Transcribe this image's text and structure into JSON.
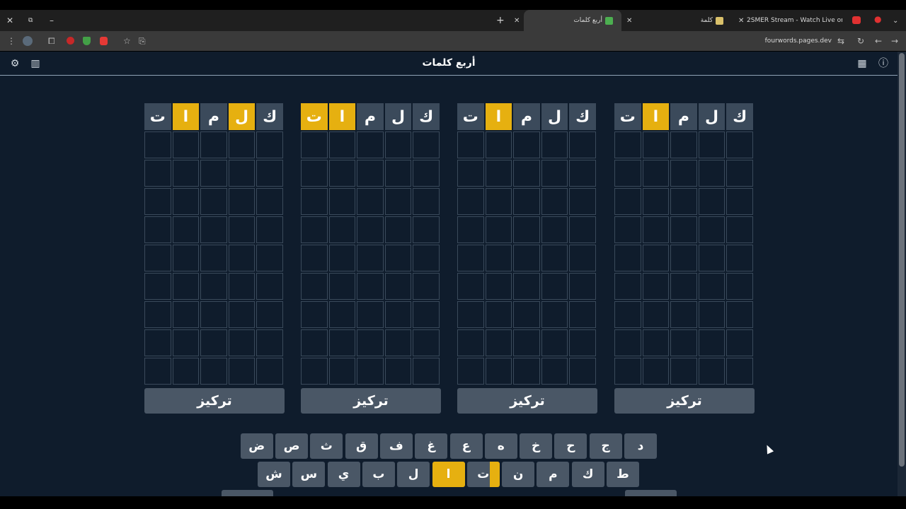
{
  "browser": {
    "tabs": [
      {
        "title": "أربع كلمات",
        "favicon_color": "#4caf50"
      },
      {
        "title": "كلمة",
        "favicon_color": "#d9c06a"
      },
      {
        "title": "2SMER Stream - Watch Live on",
        "favicon_color": "#53fc18"
      }
    ],
    "url": "fourwords.pages.dev",
    "new_tab": "+",
    "close_glyph": "✕"
  },
  "app": {
    "title": "أربع كلمات",
    "focus_label": "تركيز",
    "boards": [
      {
        "letters": [
          "ت",
          "ا",
          "م",
          "ل",
          "ك"
        ],
        "states": [
          "gray",
          "yellow",
          "gray",
          "yellow",
          "gray"
        ]
      },
      {
        "letters": [
          "ت",
          "ا",
          "م",
          "ل",
          "ك"
        ],
        "states": [
          "yellow",
          "yellow",
          "gray",
          "gray",
          "gray"
        ]
      },
      {
        "letters": [
          "ت",
          "ا",
          "م",
          "ل",
          "ك"
        ],
        "states": [
          "gray",
          "yellow",
          "gray",
          "gray",
          "gray"
        ]
      },
      {
        "letters": [
          "ت",
          "ا",
          "م",
          "ل",
          "ك"
        ],
        "states": [
          "gray",
          "yellow",
          "gray",
          "gray",
          "gray"
        ]
      }
    ],
    "keyboard": {
      "row1": [
        "د",
        "ج",
        "ح",
        "خ",
        "ه",
        "ع",
        "غ",
        "ف",
        "ق",
        "ث",
        "ص",
        "ض"
      ],
      "row2": [
        "ط",
        "ك",
        "م",
        "ن",
        "ت",
        "ا",
        "ل",
        "ب",
        "ي",
        "س",
        "ش"
      ],
      "row2_states": [
        "gray",
        "gray",
        "gray",
        "gray",
        "split",
        "yellow",
        "gray",
        "gray",
        "gray",
        "gray",
        "gray"
      ]
    }
  },
  "colors": {
    "background": "#0f1c2c",
    "tile_gray": "#3b4a5b",
    "tile_yellow": "#e6b010",
    "key_gray": "#4a5766"
  }
}
